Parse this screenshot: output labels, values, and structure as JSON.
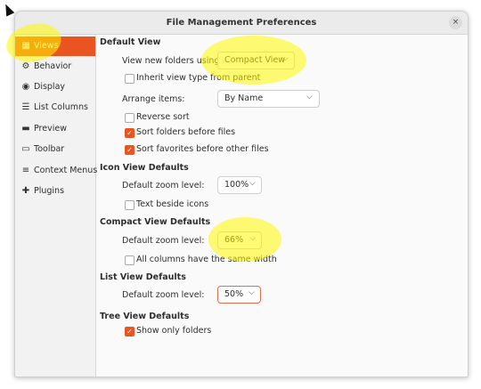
{
  "window": {
    "title": "File Management Preferences",
    "close_glyph": "×"
  },
  "sidebar": {
    "items": [
      {
        "label": "Views",
        "icon": "grid-icon",
        "glyph": "▦",
        "active": true
      },
      {
        "label": "Behavior",
        "icon": "gear-icon",
        "glyph": "⚙",
        "active": false
      },
      {
        "label": "Display",
        "icon": "eye-icon",
        "glyph": "◉",
        "active": false
      },
      {
        "label": "List Columns",
        "icon": "list-icon",
        "glyph": "☰",
        "active": false
      },
      {
        "label": "Preview",
        "icon": "monitor-icon",
        "glyph": "▬",
        "active": false
      },
      {
        "label": "Toolbar",
        "icon": "toolbar-icon",
        "glyph": "▭",
        "active": false
      },
      {
        "label": "Context Menus",
        "icon": "menu-icon",
        "glyph": "≡",
        "active": false
      },
      {
        "label": "Plugins",
        "icon": "puzzle-icon",
        "glyph": "✚",
        "active": false
      }
    ]
  },
  "default_view": {
    "heading": "Default View",
    "view_label": "View new folders using:",
    "view_value": "Compact View",
    "inherit_label": "Inherit view type from parent",
    "inherit_checked": false,
    "arrange_label": "Arrange items:",
    "arrange_value": "By Name",
    "reverse_label": "Reverse sort",
    "reverse_checked": false,
    "folders_first_label": "Sort folders before files",
    "folders_first_checked": true,
    "favorites_first_label": "Sort favorites before other files",
    "favorites_first_checked": true
  },
  "icon_view": {
    "heading": "Icon View Defaults",
    "zoom_label": "Default zoom level:",
    "zoom_value": "100%",
    "text_beside_label": "Text beside icons",
    "text_beside_checked": false
  },
  "compact_view": {
    "heading": "Compact View Defaults",
    "zoom_label": "Default zoom level:",
    "zoom_value": "66%",
    "same_width_label": "All columns have the same width",
    "same_width_checked": false
  },
  "list_view": {
    "heading": "List View Defaults",
    "zoom_label": "Default zoom level:",
    "zoom_value": "50%"
  },
  "tree_view": {
    "heading": "Tree View Defaults",
    "only_folders_label": "Show only folders",
    "only_folders_checked": true
  },
  "colors": {
    "accent": "#e95420",
    "highlight": "#fff800"
  },
  "chevron_glyph": "⌵",
  "check_glyph": "✓"
}
